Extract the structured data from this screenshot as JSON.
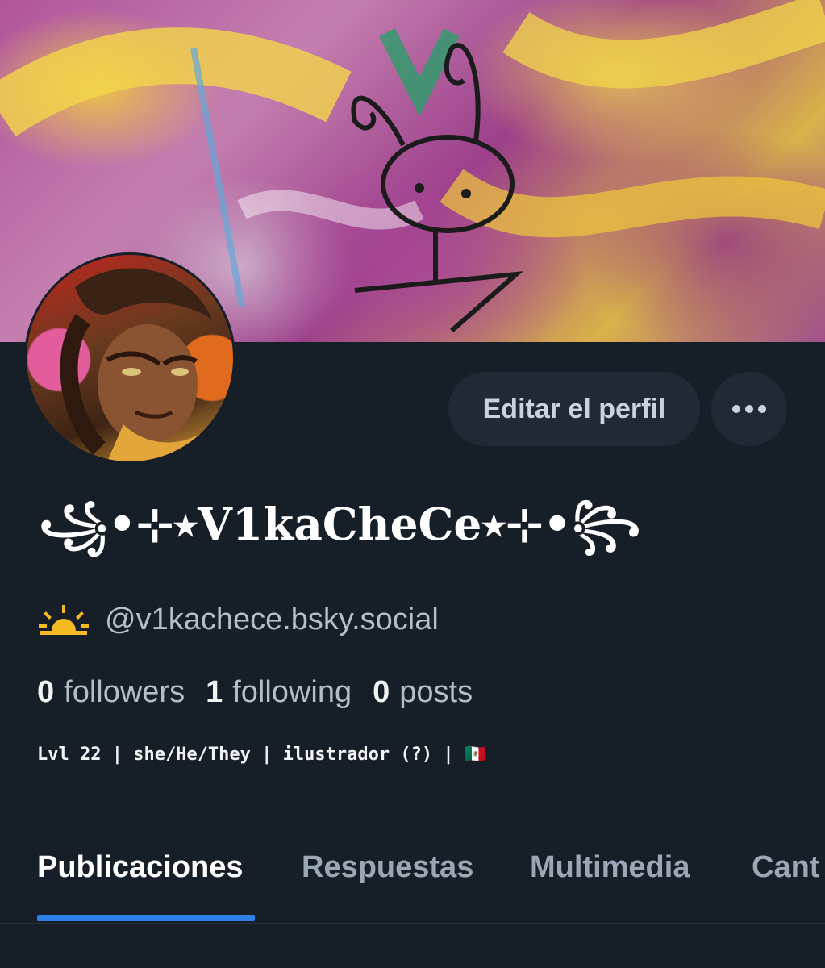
{
  "profile": {
    "display_name": "꧁•⊹٭V1kaCheCe٭⊹•꧂",
    "handle_icon": "sunrise-icon",
    "handle": "@v1kachece.bsky.social",
    "bio": "Lvl 22 | she/He/They | ilustrador (?) | 🇲🇽"
  },
  "actions": {
    "edit_profile_label": "Editar el perfil",
    "more_label": "•••"
  },
  "stats": {
    "followers_count": "0",
    "followers_label": "followers",
    "following_count": "1",
    "following_label": "following",
    "posts_count": "0",
    "posts_label": "posts"
  },
  "tabs": [
    {
      "label": "Publicaciones",
      "active": true
    },
    {
      "label": "Respuestas",
      "active": false
    },
    {
      "label": "Multimedia",
      "active": false
    },
    {
      "label": "Cant",
      "active": false
    }
  ],
  "colors": {
    "background": "#161e27",
    "accent": "#2b7fe6",
    "button_bg": "#1f2a36",
    "muted_text": "#b4bec9"
  }
}
